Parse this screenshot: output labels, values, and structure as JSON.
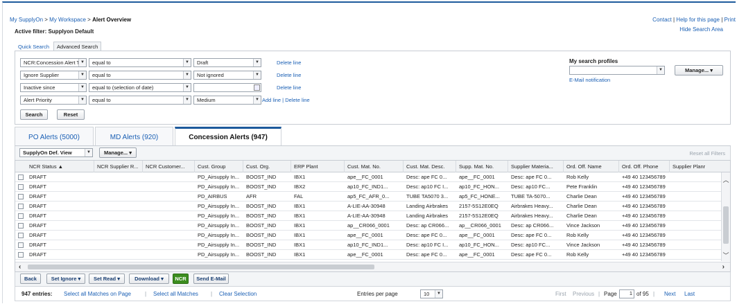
{
  "breadcrumb": {
    "part1": "My SupplyOn",
    "part2": "My Workspace",
    "current": "Alert Overview",
    "sep": ">"
  },
  "top_links": {
    "contact": "Contact",
    "help": "Help for this page",
    "print": "Print",
    "hide_search": "Hide Search Area"
  },
  "active_filter": "Active filter: Supplyon Default",
  "search_tabs": [
    "Quick Search",
    "Advanced Search"
  ],
  "criteria": [
    {
      "field": "NCR:Concession Alert Trigger",
      "operator": "equal to",
      "value": "Draft",
      "action": "Delete line"
    },
    {
      "field": "Ignore Supplier",
      "operator": "equal to",
      "value": "Not ignored",
      "action": "Delete line"
    },
    {
      "field": "Inactive since",
      "operator": "equal to (selection of date)",
      "value": "",
      "action": "Delete line"
    },
    {
      "field": "Alert Priority",
      "operator": "equal to",
      "value": "Medium",
      "action": "Add line | Delete line"
    }
  ],
  "search_button": "Search",
  "reset_button": "Reset",
  "profiles": {
    "title": "My search profiles",
    "value": "",
    "manage": "Manage...",
    "email": "E-Mail notification"
  },
  "result_tabs": [
    "PO Alerts (5000)",
    "MD Alerts (920)",
    "Concession Alerts (947)"
  ],
  "toolbar": {
    "view": "SupplyOn Def. View",
    "manage": "Manage...",
    "reset_filters": "Reset all Filters"
  },
  "columns": [
    "NCR Status ▲",
    "NCR Supplier R...",
    "NCR Customer...",
    "Cust. Group",
    "Cust. Org.",
    "ERP Plant",
    "Cust. Mat. No.",
    "Cust. Mat. Desc.",
    "Supp. Mat. No.",
    "Supplier Materia...",
    "Ord. Off. Name",
    "Ord. Off. Phone",
    "Supplier Planr"
  ],
  "rows": [
    [
      "DRAFT",
      "",
      "",
      "PD_Airsupply In...",
      "BOOST_IND",
      "IBX1",
      "ape__FC_0001",
      "Desc: ape FC 0...",
      "ape__FC_0001",
      "Desc: ape FC 0...",
      "Rob Kelly",
      "+49 40 123456789",
      ""
    ],
    [
      "DRAFT",
      "",
      "",
      "PD_Airsupply In...",
      "BOOST_IND",
      "IBX2",
      "ap10_FC_IND1...",
      "Desc: ap10 FC I...",
      "ap10_FC_HON...",
      "Desc: ap10 FC...",
      "Pete Franklin",
      "+49 40 123456789",
      ""
    ],
    [
      "DRAFT",
      "",
      "",
      "PD_AIRBUS",
      "AFR",
      "FAL",
      "ap5_FC_AFR_0...",
      "TUBE TA5070 3...",
      "ap5_FC_HONE...",
      "TUBE TA-5070...",
      "Charlie Dean",
      "+49 40 123456789",
      ""
    ],
    [
      "DRAFT",
      "",
      "",
      "PD_Airsupply In...",
      "BOOST_IND",
      "IBX1",
      "A-LIE-AA-30948",
      "Landing Airbrakes",
      "2157-5S12E0EQ",
      "Airbrakes Heavy...",
      "Charlie Dean",
      "+49 40 123456789",
      ""
    ],
    [
      "DRAFT",
      "",
      "",
      "PD_Airsupply In...",
      "BOOST_IND",
      "IBX1",
      "A-LIE-AA-30948",
      "Landing Airbrakes",
      "2157-5S12E0EQ",
      "Airbrakes Heavy...",
      "Charlie Dean",
      "+49 40 123456789",
      ""
    ],
    [
      "DRAFT",
      "",
      "",
      "PD_Airsupply In...",
      "BOOST_IND",
      "IBX1",
      "ap__CR066_0001",
      "Desc: ap CR066...",
      "ap__CR066_0001",
      "Desc: ap CR066...",
      "Vince Jackson",
      "+49 40 123456789",
      ""
    ],
    [
      "DRAFT",
      "",
      "",
      "PD_Airsupply In...",
      "BOOST_IND",
      "IBX1",
      "ape__FC_0001",
      "Desc: ape FC 0...",
      "ape__FC_0001",
      "Desc: ape FC 0...",
      "Rob Kelly",
      "+49 40 123456789",
      ""
    ],
    [
      "DRAFT",
      "",
      "",
      "PD_Airsupply In...",
      "BOOST_IND",
      "IBX1",
      "ap10_FC_IND1...",
      "Desc: ap10 FC I...",
      "ap10_FC_HON...",
      "Desc: ap10 FC...",
      "Vince Jackson",
      "+49 40 123456789",
      ""
    ],
    [
      "DRAFT",
      "",
      "",
      "PD_Airsupply In...",
      "BOOST_IND",
      "IBX1",
      "ape__FC_0001",
      "Desc: ape FC 0...",
      "ape__FC_0001",
      "Desc: ape FC 0...",
      "Rob Kelly",
      "+49 40 123456789",
      ""
    ]
  ],
  "bottom_buttons": {
    "back": "Back",
    "set_ignore": "Set Ignore",
    "set_read": "Set Read",
    "download": "Download",
    "ncr": "NCR",
    "send_email": "Send E-Mail"
  },
  "footer": {
    "entries": "947 entries:",
    "select_page": "Select all Matches on Page",
    "select_all": "Select all Matches",
    "clear": "Clear Selection",
    "per_page_label": "Entries per page",
    "per_page": "10",
    "first": "First",
    "previous": "Previous",
    "page_label": "Page",
    "page": "1",
    "of": "of 95",
    "next": "Next",
    "last": "Last"
  },
  "colors": {
    "accent": "#1d5a9c",
    "link": "#1a5fb4",
    "ncr_button": "#3c8d1f"
  }
}
